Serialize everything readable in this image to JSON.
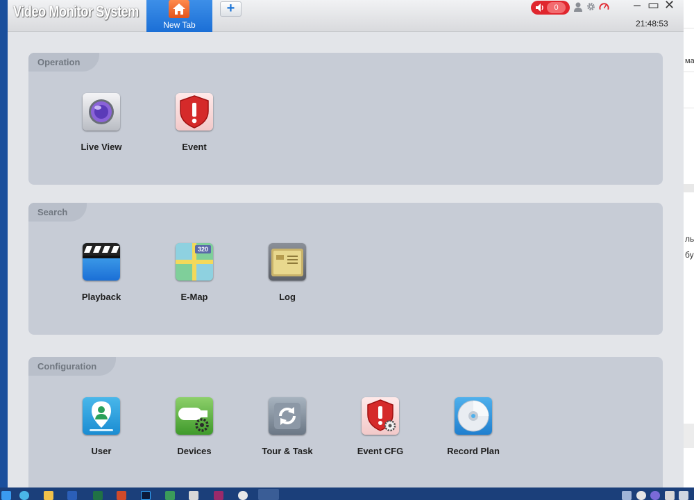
{
  "window": {
    "title": "Video Monitor System",
    "tab_label": "New Tab",
    "add_tab": "+",
    "alarm_count": "0",
    "clock": "21:48:53",
    "minimize": "–",
    "maximize": "▭",
    "close": "✕"
  },
  "sections": {
    "operation": {
      "title": "Operation",
      "items": {
        "live_view": "Live View",
        "event": "Event"
      }
    },
    "search": {
      "title": "Search",
      "items": {
        "playback": "Playback",
        "emap": "E-Map",
        "log": "Log"
      }
    },
    "configuration": {
      "title": "Configuration",
      "items": {
        "user": "User",
        "devices": "Devices",
        "tour_task": "Tour & Task",
        "event_cfg": "Event CFG",
        "record_plan": "Record Plan"
      }
    }
  },
  "icons": {
    "emap_badge": "320"
  },
  "colors": {
    "accent_tab": "#1b6fd6",
    "alarm_red": "#e0262e",
    "panel_bg": "#c7ccd6"
  },
  "background_window": {
    "fragments": [
      "ма",
      "ль",
      "бу"
    ]
  }
}
